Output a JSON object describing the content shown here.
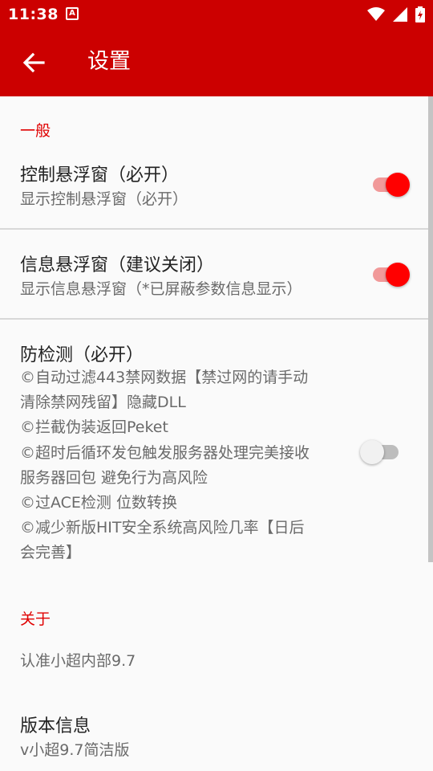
{
  "status": {
    "time": "11:38",
    "notif_letter": "A"
  },
  "appbar": {
    "title": "设置"
  },
  "sections": {
    "general": {
      "label": "一般"
    },
    "about": {
      "label": "关于"
    }
  },
  "settings": {
    "control_float": {
      "title": "控制悬浮窗（必开）",
      "summary": "显示控制悬浮窗（必开）",
      "enabled": true
    },
    "info_float": {
      "title": "信息悬浮窗（建议关闭）",
      "summary": "显示信息悬浮窗（*已屏蔽参数信息显示）",
      "enabled": true
    },
    "anti_detect": {
      "title": "防检测（必开）",
      "summary_lines": [
        "©自动过滤443禁网数据【禁过网的请手动",
        "清除禁网残留】隐藏DLL",
        "©拦截伪装返回Peket",
        "©超时后循环发包触发服务器处理完美接收",
        "服务器回包 避免行为高风险",
        "©过ACE检测 位数转换",
        "©减少新版HIT安全系统高风险几率【日后",
        "会完善】"
      ],
      "enabled": false
    }
  },
  "about": {
    "brand": "认准小超内部9.7",
    "version_title": "版本信息",
    "version_value": "v小超9.7简洁版"
  },
  "colors": {
    "accent": "#cc0000",
    "switch_on": "#ff0000"
  }
}
